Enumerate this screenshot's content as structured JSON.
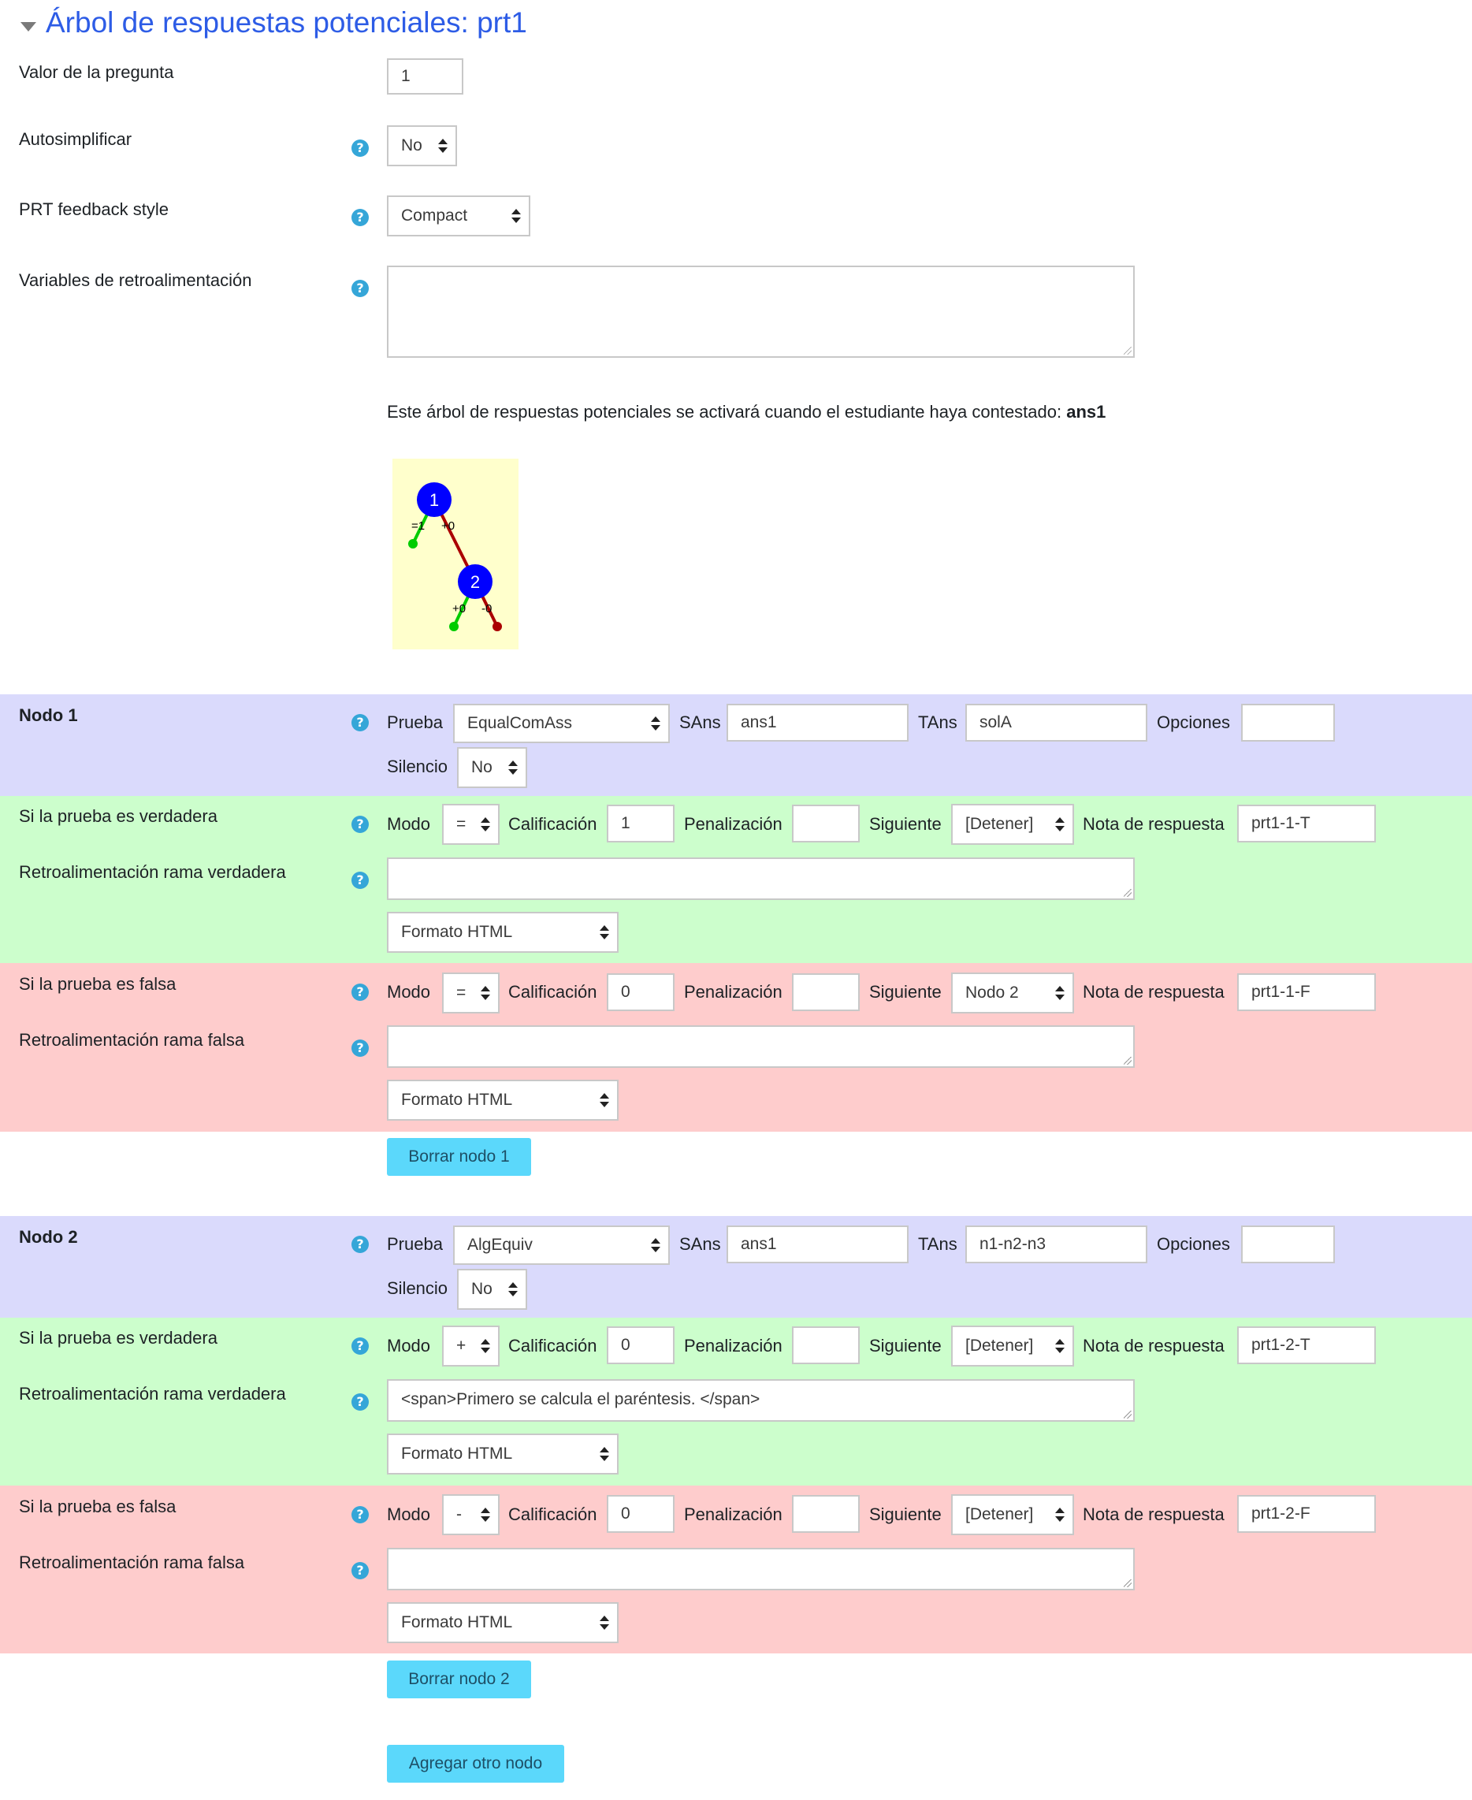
{
  "header": {
    "title": "Árbol de respuestas potenciales: prt1"
  },
  "settings": {
    "question_value_label": "Valor de la pregunta",
    "question_value": "1",
    "autosimplify_label": "Autosimplificar",
    "autosimplify_value": "No",
    "feedback_style_label": "PRT feedback style",
    "feedback_style_value": "Compact",
    "feedback_vars_label": "Variables de retroalimentación",
    "feedback_vars_value": ""
  },
  "activation": {
    "text": "Este árbol de respuestas potenciales se activará cuando el estudiante haya contestado: ",
    "answer": "ans1"
  },
  "tree": {
    "node1": "1",
    "node2": "2",
    "n1_true": "=1",
    "n1_false": "+0",
    "n2_true": "+0",
    "n2_false": "-0",
    "colors": {
      "node": "#0000ff",
      "true": "#00cc00",
      "false": "#aa0000",
      "bg": "#ffffcc"
    }
  },
  "labels": {
    "test": "Prueba",
    "sans": "SAns",
    "tans": "TAns",
    "options": "Opciones",
    "quiet": "Silencio",
    "if_true": "Si la prueba es verdadera",
    "if_false": "Si la prueba es falsa",
    "feedback_true": "Retroalimentación rama verdadera",
    "feedback_false": "Retroalimentación rama falsa",
    "mode": "Modo",
    "score": "Calificación",
    "penalty": "Penalización",
    "next": "Siguiente",
    "answer_note": "Nota de respuesta",
    "format": "Formato HTML"
  },
  "nodes": [
    {
      "title": "Nodo 1",
      "test": "EqualComAss",
      "sans": "ans1",
      "tans": "solA",
      "options": "",
      "quiet": "No",
      "true_branch": {
        "mode": "=",
        "score": "1",
        "penalty": "",
        "next": "[Detener]",
        "note": "prt1-1-T",
        "feedback": ""
      },
      "false_branch": {
        "mode": "=",
        "score": "0",
        "penalty": "",
        "next": "Nodo 2",
        "note": "prt1-1-F",
        "feedback": ""
      },
      "delete_label": "Borrar nodo 1"
    },
    {
      "title": "Nodo 2",
      "test": "AlgEquiv",
      "sans": "ans1",
      "tans": "n1-n2-n3",
      "options": "",
      "quiet": "No",
      "true_branch": {
        "mode": "+",
        "score": "0",
        "penalty": "",
        "next": "[Detener]",
        "note": "prt1-2-T",
        "feedback": "<span>Primero se calcula el paréntesis. </span>"
      },
      "false_branch": {
        "mode": "-",
        "score": "0",
        "penalty": "",
        "next": "[Detener]",
        "note": "prt1-2-F",
        "feedback": ""
      },
      "delete_label": "Borrar nodo 2"
    }
  ],
  "add_node_label": "Agregar otro nodo"
}
